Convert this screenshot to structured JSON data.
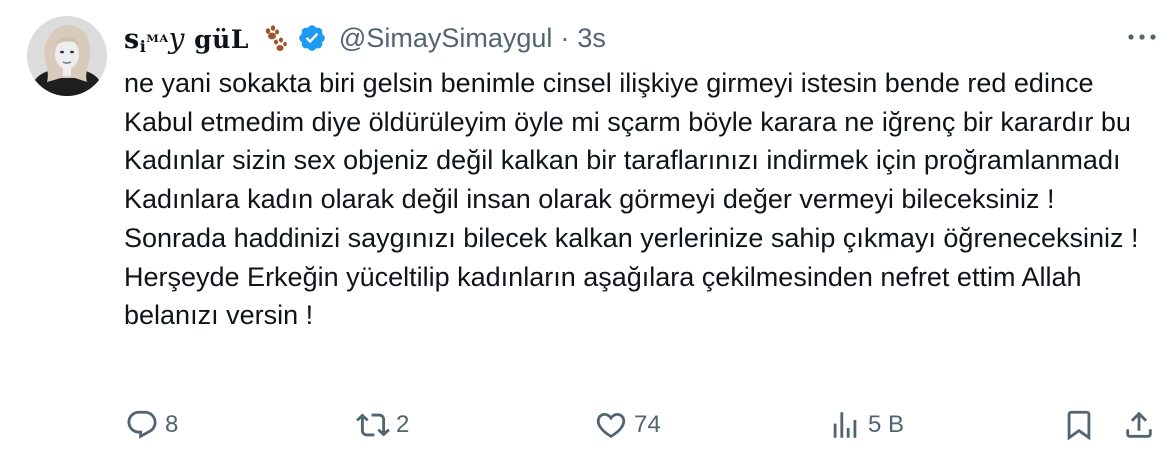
{
  "tweet": {
    "author": {
      "name_parts": [
        "s",
        "i",
        "ᴹᴬ",
        "y",
        " gü",
        "L"
      ],
      "emoji": "paw-prints-icon",
      "verified": true,
      "handle": "@SimaySimaygul",
      "separator": "·",
      "time": "3s"
    },
    "text": "ne yani sokakta biri gelsin benimle cinsel ilişkiye girmeyi istesin bende red edince Kabul etmedim diye öldürüleyim öyle mi sçarm böyle karara ne iğrenç bir karardır bu Kadınlar sizin sex objeniz değil kalkan bir taraflarınızı indirmek için proğramlanmadı Kadınlara kadın olarak değil insan olarak görmeyi değer vermeyi bileceksiniz ! Sonrada haddinizi saygınızı bilecek kalkan yerlerinize sahip çıkmayı öğreneceksiniz ! Herşeyde Erkeğin yüceltilip kadınların aşağılara çekilmesinden nefret ettim Allah belanızı versin !",
    "actions": {
      "replies": "8",
      "reposts": "2",
      "likes": "74",
      "views": "5 B"
    },
    "colors": {
      "text": "#0f1419",
      "muted": "#536471",
      "verified": "#1d9bf0",
      "paw": "#a0522d"
    }
  }
}
